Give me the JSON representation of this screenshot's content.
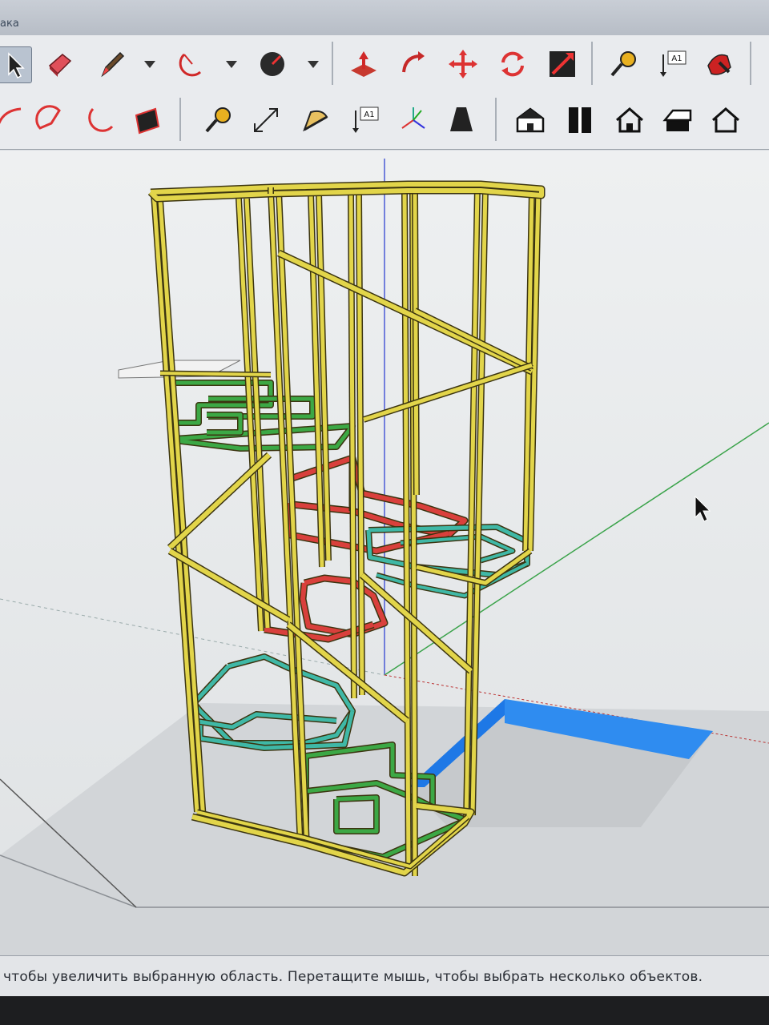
{
  "window": {
    "title_fragment": "ака"
  },
  "toolbar_row1": {
    "tools": [
      {
        "name": "select-arrow-icon"
      },
      {
        "name": "eraser-icon"
      },
      {
        "name": "pencil-icon"
      },
      {
        "name": "arc-icon"
      },
      {
        "name": "paint-bucket-icon"
      },
      {
        "name": "push-pull-icon"
      },
      {
        "name": "follow-me-icon"
      },
      {
        "name": "move-icon"
      },
      {
        "name": "rotate-icon"
      },
      {
        "name": "scale-icon"
      },
      {
        "name": "tape-measure-icon"
      },
      {
        "name": "text-label-icon"
      },
      {
        "name": "paint-icon"
      }
    ],
    "text_tool_label": "A1"
  },
  "toolbar_row2": {
    "tools": [
      {
        "name": "arc-2pt-icon"
      },
      {
        "name": "pie-icon"
      },
      {
        "name": "arc-3pt-icon"
      },
      {
        "name": "rectangle-rotated-icon"
      },
      {
        "name": "tape-measure-icon"
      },
      {
        "name": "dimension-icon"
      },
      {
        "name": "protractor-icon"
      },
      {
        "name": "text-icon"
      },
      {
        "name": "axes-icon"
      },
      {
        "name": "3d-text-icon"
      },
      {
        "name": "iso-view-icon"
      },
      {
        "name": "top-view-icon"
      },
      {
        "name": "front-view-icon"
      },
      {
        "name": "right-view-icon"
      },
      {
        "name": "back-view-icon"
      }
    ],
    "text_tool_label": "A1"
  },
  "colors": {
    "frame": "#e2d54a",
    "frame_edge": "#3b3410",
    "stair_green": "#3ca845",
    "stair_red": "#d9403c",
    "stair_cyan": "#3fb8a6",
    "pool_blue": "#1e78e6",
    "ground": "#cdd0d3",
    "axis_green": "#3aa34a",
    "axis_blue": "#4a5ad6"
  },
  "status": {
    "text": "чтобы увеличить выбранную область. Перетащите мышь, чтобы выбрать несколько объектов."
  }
}
